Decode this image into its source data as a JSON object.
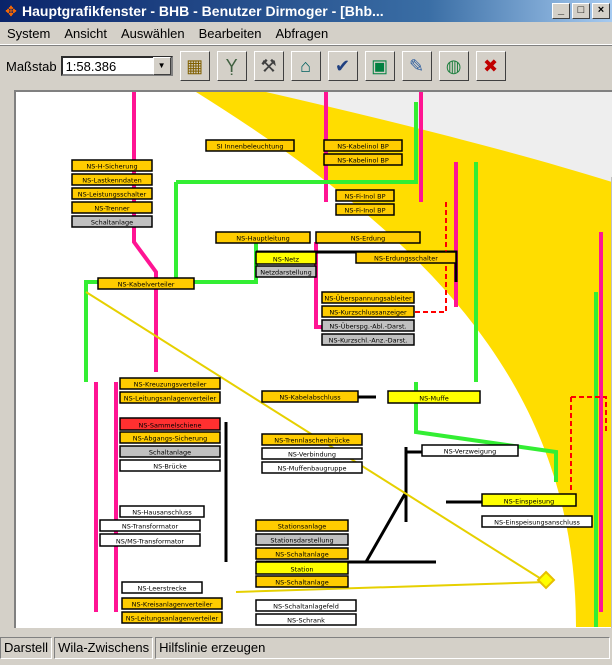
{
  "window": {
    "title": "Hauptgrafikfenster - BHB - Benutzer Dirmoger  - [Bhb...",
    "min_icon": "minimize-icon",
    "max_icon": "maximize-icon",
    "close_icon": "close-icon"
  },
  "menu": [
    "System",
    "Ansicht",
    "Auswählen",
    "Bearbeiten",
    "Abfragen"
  ],
  "toolbar": {
    "scale_label": "Maßstab",
    "scale_value": "1:58.386",
    "buttons": [
      "save-disk-icon",
      "wrench-icon",
      "tool-person-icon",
      "node-icon",
      "edit-check-icon",
      "monitor-icon",
      "paint-icon",
      "globe-icon",
      "cross-icon"
    ]
  },
  "status": {
    "pane1": "Darstell",
    "pane2": "Wila-Zwischens",
    "pane3": "Hilfslinie  erzeugen"
  },
  "diagram": {
    "nodes": [
      {
        "id": "n1",
        "label": "SI Innenbeleuchtung",
        "color": "#ffcc00"
      },
      {
        "id": "n2",
        "label": "NS-Kabelinol BP",
        "color": "#ffcc00"
      },
      {
        "id": "n3",
        "label": "NS-Kabelinol BP",
        "color": "#ffcc00"
      },
      {
        "id": "n4",
        "label": "NS-Fi-Inol BP",
        "color": "#ffcc00"
      },
      {
        "id": "n5",
        "label": "NS-Fi-Inol BP",
        "color": "#ffcc00"
      },
      {
        "id": "n6",
        "label": "NS-H-Sicherung",
        "color": "#ffcc00"
      },
      {
        "id": "n7",
        "label": "NS-Lastkenndaten",
        "color": "#ffcc00"
      },
      {
        "id": "n8",
        "label": "NS-Leistungsschalter",
        "color": "#ffcc00"
      },
      {
        "id": "n9",
        "label": "NS-Trenner",
        "color": "#ffcc00"
      },
      {
        "id": "n10",
        "label": "Schaltanlage",
        "color": "#c0c0c0"
      },
      {
        "id": "n11",
        "label": "NS-Hauptleitung",
        "color": "#ffcc00"
      },
      {
        "id": "n12",
        "label": "NS-Erdung",
        "color": "#ffcc00"
      },
      {
        "id": "n13",
        "label": "NS-Netz",
        "color": "#ffff00"
      },
      {
        "id": "n14",
        "label": "Netzdarstellung",
        "color": "#c0c0c0"
      },
      {
        "id": "n15",
        "label": "NS-Überspannungsableiter",
        "color": "#ffcc00"
      },
      {
        "id": "n16",
        "label": "NS-Kurzschlussanzeiger",
        "color": "#ffcc00"
      },
      {
        "id": "n17",
        "label": "NS-Überspg.-Abl.-Darst.",
        "color": "#c0c0c0"
      },
      {
        "id": "n18",
        "label": "NS-Kurzschl.-Anz.-Darst.",
        "color": "#c0c0c0"
      },
      {
        "id": "n19",
        "label": "NS-Erdungsschalter",
        "color": "#ffcc00"
      },
      {
        "id": "n20",
        "label": "NS-Kabelverteiler",
        "color": "#ffcc00"
      },
      {
        "id": "n21",
        "label": "NS-Kreuzungsverteiler",
        "color": "#ffcc00"
      },
      {
        "id": "n22",
        "label": "NS-Leitungsanlagenverteiler",
        "color": "#ffcc00"
      },
      {
        "id": "n23",
        "label": "NS-Sammelschiene",
        "color": "#ff3030"
      },
      {
        "id": "n24",
        "label": "NS-Abgangs-Sicherung",
        "color": "#ffcc00"
      },
      {
        "id": "n25",
        "label": "Schaltanlage",
        "color": "#c0c0c0"
      },
      {
        "id": "n26",
        "label": "NS-Brücke",
        "color": "#ffffff"
      },
      {
        "id": "n27",
        "label": "NS-Kabelabschluss",
        "color": "#ffcc00"
      },
      {
        "id": "n28",
        "label": "NS-Trennlaschenbrücke",
        "color": "#ffcc00"
      },
      {
        "id": "n29",
        "label": "NS-Verbindung",
        "color": "#ffffff"
      },
      {
        "id": "n30",
        "label": "NS-Muffenbaugruppe",
        "color": "#ffffff"
      },
      {
        "id": "n31",
        "label": "NS-Muffe",
        "color": "#ffff00"
      },
      {
        "id": "n32",
        "label": "NS-Verzweigung",
        "color": "#ffffff"
      },
      {
        "id": "n33",
        "label": "NS-Einspeisung",
        "color": "#ffff00"
      },
      {
        "id": "n34",
        "label": "NS-Einspeisungsanschluss",
        "color": "#ffffff"
      },
      {
        "id": "n35",
        "label": "NS-Hausanschluss",
        "color": "#ffffff"
      },
      {
        "id": "n36",
        "label": "NS-Transformator",
        "color": "#ffffff"
      },
      {
        "id": "n37",
        "label": "NS/MS-Transformator",
        "color": "#ffffff"
      },
      {
        "id": "n38",
        "label": "Stationsanlage",
        "color": "#ffcc00"
      },
      {
        "id": "n39",
        "label": "Stationsdarstellung",
        "color": "#c0c0c0"
      },
      {
        "id": "n40",
        "label": "NS-Schaltanlage",
        "color": "#ffcc00"
      },
      {
        "id": "n41",
        "label": "Station",
        "color": "#ffff00"
      },
      {
        "id": "n42",
        "label": "NS-Schaltanlage",
        "color": "#ffcc00"
      },
      {
        "id": "n43",
        "label": "NS-Leerstrecke",
        "color": "#ffffff"
      },
      {
        "id": "n44",
        "label": "NS-Kreisanlagenverteiler",
        "color": "#ffcc00"
      },
      {
        "id": "n45",
        "label": "NS-Leitungsanlagenverteiler",
        "color": "#ffcc00"
      },
      {
        "id": "n46",
        "label": "NS-Schaltanlagefeld",
        "color": "#ffffff"
      },
      {
        "id": "n47",
        "label": "NS-Schrank",
        "color": "#ffffff"
      }
    ]
  }
}
